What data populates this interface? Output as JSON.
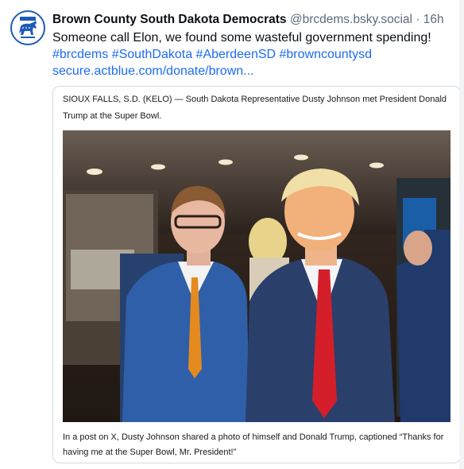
{
  "post": {
    "author_name": "Brown County South Dakota Democrats",
    "handle": "@brcdems.bsky.social",
    "separator": "·",
    "time": "16h",
    "text": "Someone call Elon, we found some wasteful government spending!",
    "hashtags": "#brcdems #SouthDakota #AberdeenSD #browncountysd",
    "link": "secure.actblue.com/donate/brown..."
  },
  "card": {
    "summary": "SIOUX FALLS, S.D. (KELO) — South Dakota Representative Dusty Johnson met President Donald Trump at the Super Bowl.",
    "caption": "In a post on X, Dusty Johnson shared a photo of himself and Donald Trump, captioned “Thanks for having me at the Super Bowl, Mr. President!”"
  },
  "avatar": {
    "icon": "donkey-logo-icon",
    "colors": {
      "ring": "#1e5bb8",
      "donkey": "#1e5bb8"
    }
  },
  "colors": {
    "link": "#1d6bf3",
    "handle": "#5b6b7c",
    "border": "#d4dbe2"
  }
}
